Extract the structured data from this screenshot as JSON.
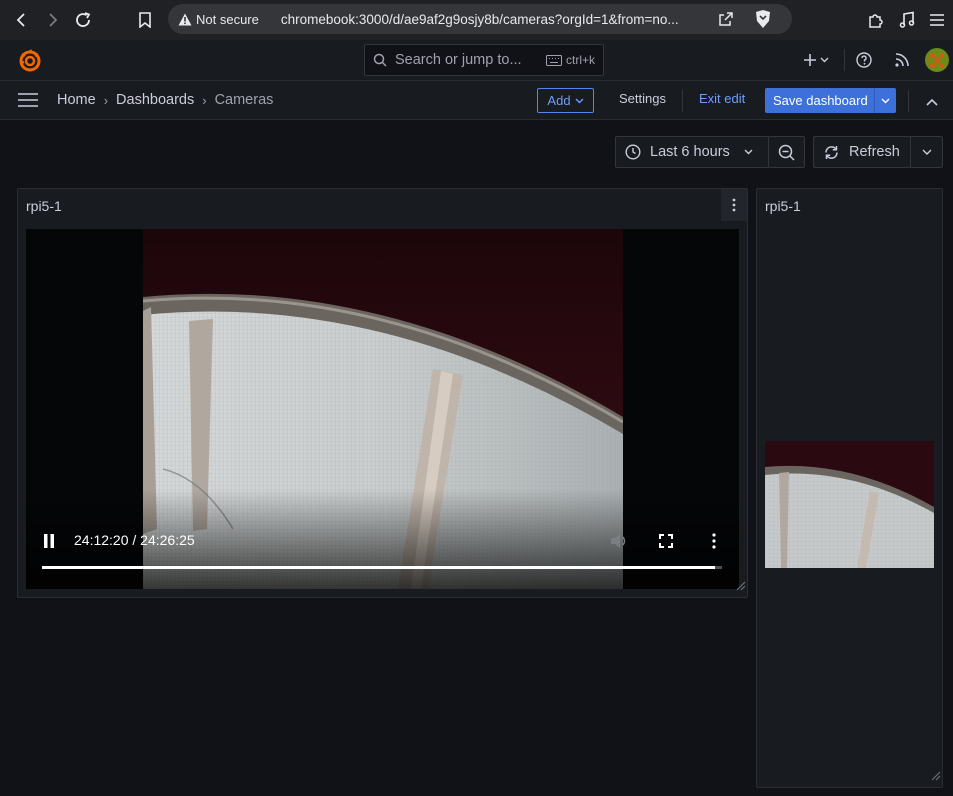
{
  "browser": {
    "not_secure": "Not secure",
    "url": "chromebook:3000/d/ae9af2g9osjy8b/cameras?orgId=1&from=no..."
  },
  "topbar": {
    "search_placeholder": "Search or jump to...",
    "shortcut": "ctrl+k"
  },
  "breadcrumb": [
    "Home",
    "Dashboards",
    "Cameras"
  ],
  "toolbar": {
    "add_label": "Add",
    "settings_label": "Settings",
    "exit_label": "Exit edit",
    "save_label": "Save dashboard"
  },
  "time": {
    "range_label": "Last 6 hours",
    "refresh_label": "Refresh"
  },
  "panels": [
    {
      "title": "rpi5-1",
      "video": {
        "time_text": "24:12:20 / 24:26:25",
        "progress": 0.99
      }
    },
    {
      "title": "rpi5-1"
    }
  ],
  "colors": {
    "accent": "#3d71d9",
    "link": "#6e9fff",
    "background": "#111217",
    "panel": "#181b1f"
  }
}
